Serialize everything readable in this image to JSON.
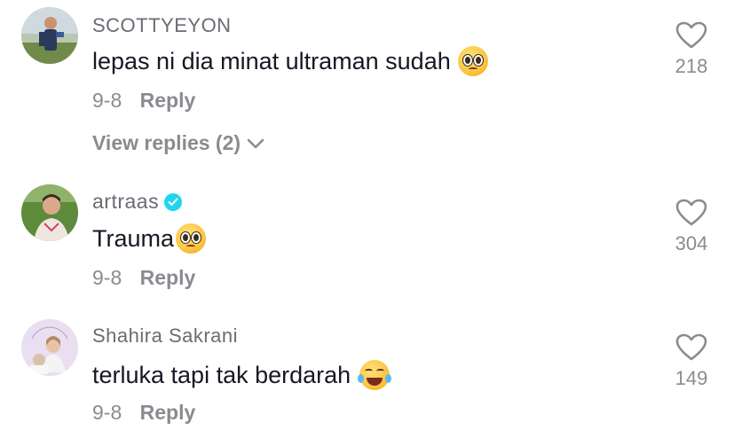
{
  "comments": [
    {
      "username": "SCOTTYEYON",
      "text": "lepas ni dia minat ultraman sudah",
      "emoji": "pleading-face",
      "date": "9-8",
      "reply_label": "Reply",
      "likes": "218",
      "view_replies": "View replies (2)",
      "verified": false
    },
    {
      "username": "artraas",
      "text": "Trauma",
      "emoji": "pleading-face",
      "date": "9-8",
      "reply_label": "Reply",
      "likes": "304",
      "verified": true
    },
    {
      "username": "Shahira Sakrani",
      "text": "terluka tapi tak berdarah",
      "emoji": "face-with-tears-of-joy",
      "date": "9-8",
      "reply_label": "Reply",
      "likes": "149",
      "verified": false
    }
  ],
  "colors": {
    "text": "#161823",
    "secondary": "#8a8b91",
    "verified": "#20d5ec"
  }
}
